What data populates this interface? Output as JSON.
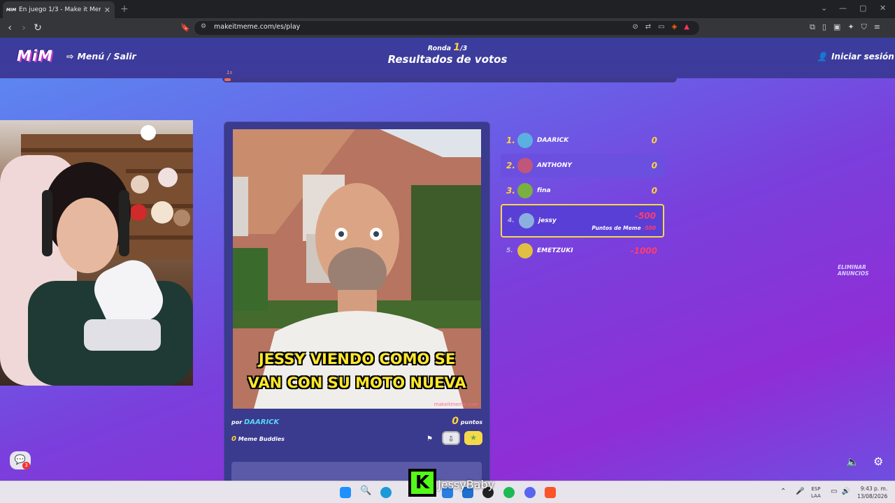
{
  "browser": {
    "tab_title": "En juego 1/3 - Make it Meme",
    "tab_favicon_text": "MIM",
    "url": "makeitmeme.com/es/play"
  },
  "header": {
    "logo": "MiM",
    "menu_label": "Menú / Salir",
    "round_label": "Ronda",
    "round_current": "1",
    "round_total": "/3",
    "phase_title": "Resultados de votos",
    "login_label": "Iniciar sesión",
    "timer_label": "1s"
  },
  "meme": {
    "caption_line1": "JESSY VIENDO COMO SE",
    "caption_line2": "VAN CON SU MOTO NUEVA",
    "watermark": "makeitmeme.com",
    "by_prefix": "por",
    "author": "DAARICK",
    "points_value": "0",
    "points_label": "puntos",
    "buddies_value": "0",
    "buddies_label": "Meme Buddies"
  },
  "leaderboard": [
    {
      "rank": "1.",
      "name": "DAARICK",
      "score": "0",
      "avatar_color": "#5ab0e0"
    },
    {
      "rank": "2.",
      "name": "ANTHONY",
      "score": "0",
      "avatar_color": "#c0567a"
    },
    {
      "rank": "3.",
      "name": "fina",
      "score": "0",
      "avatar_color": "#7ab040"
    },
    {
      "rank": "4.",
      "name": "jessy",
      "score": "-500",
      "avatar_color": "#8ab0e0",
      "sub_label": "Puntos de Meme",
      "sub_value": "-500"
    },
    {
      "rank": "5.",
      "name": "EMETZUKI",
      "score": "-1000",
      "avatar_color": "#e0c040"
    }
  ],
  "remove_ads": "ELIMINAR ANUNCIOS",
  "chat_badge": "3",
  "stream": {
    "name": "JessyBaby"
  },
  "taskbar": {
    "lang_1": "ESP",
    "lang_2": "LAA",
    "time": "9:43 p. m.",
    "date": "13/08/2026"
  },
  "colors": {
    "accent_yellow": "#ffd33d",
    "negative": "#ff3d6e",
    "author_cyan": "#57d8f5"
  }
}
